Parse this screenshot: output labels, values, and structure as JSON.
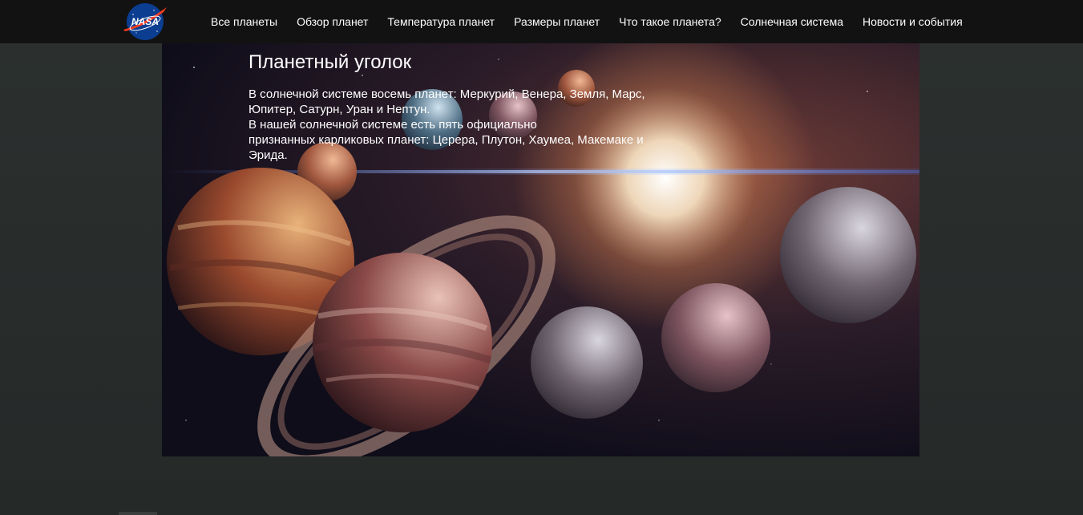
{
  "header": {
    "logo_text": "NASA",
    "nav": [
      {
        "label": "Все планеты"
      },
      {
        "label": "Обзор планет"
      },
      {
        "label": "Температура планет"
      },
      {
        "label": "Размеры планет"
      },
      {
        "label": "Что такое планета?"
      },
      {
        "label": "Солнечная система"
      },
      {
        "label": "Новости и события"
      }
    ]
  },
  "hero": {
    "title": "Планетный уголок",
    "lines": [
      "В солнечной системе восемь планет: Меркурий, Венера, Земля, Марс,",
      "Юпитер, Сатурн, Уран и Нептун.",
      "В нашей солнечной системе есть пять официально",
      "признанных карликовых планет: Церера, Плутон, Хаумеа, Макемаке и",
      "Эрида."
    ]
  },
  "colors": {
    "topbar": "#121212",
    "page_background": "#262a29",
    "nav_text": "#ffffff",
    "logo_blue": "#0b3d91",
    "logo_red": "#fc3d21"
  },
  "icons": {
    "logo": "nasa-meatball-logo"
  }
}
